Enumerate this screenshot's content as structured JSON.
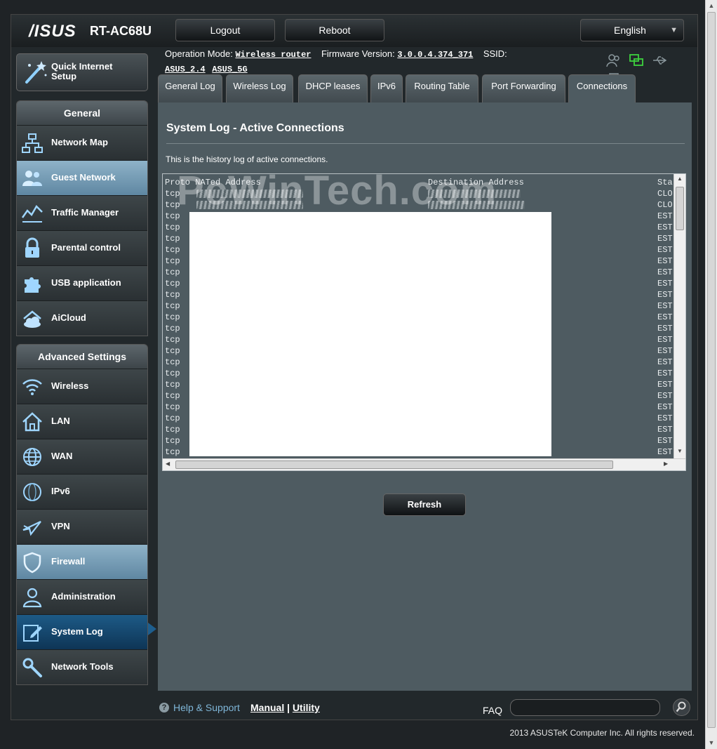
{
  "header": {
    "brand": "/ISUS",
    "model": "RT-AC68U",
    "logout_label": "Logout",
    "reboot_label": "Reboot",
    "language": "English"
  },
  "info": {
    "op_mode_label": "Operation Mode:",
    "op_mode_value": "Wireless router",
    "firmware_label": "Firmware Version:",
    "firmware_value": "3.0.0.4.374_371",
    "ssid_label": "SSID:",
    "ssid_values": [
      "ASUS_2.4",
      "ASUS_5G"
    ]
  },
  "sidebar": {
    "quick_setup_line1": "Quick Internet",
    "quick_setup_line2": "Setup",
    "general_title": "General",
    "general_items": [
      {
        "label": "Network Map",
        "icon": "network-map-icon"
      },
      {
        "label": "Guest Network",
        "icon": "guest-network-icon"
      },
      {
        "label": "Traffic Manager",
        "icon": "traffic-manager-icon"
      },
      {
        "label": "Parental control",
        "icon": "lock-icon"
      },
      {
        "label": "USB application",
        "icon": "puzzle-icon"
      },
      {
        "label": "AiCloud",
        "icon": "cloud-icon"
      }
    ],
    "advanced_title": "Advanced Settings",
    "advanced_items": [
      {
        "label": "Wireless",
        "icon": "wifi-icon"
      },
      {
        "label": "LAN",
        "icon": "home-icon"
      },
      {
        "label": "WAN",
        "icon": "globe-icon"
      },
      {
        "label": "IPv6",
        "icon": "ipv6-icon"
      },
      {
        "label": "VPN",
        "icon": "vpn-icon"
      },
      {
        "label": "Firewall",
        "icon": "shield-icon"
      },
      {
        "label": "Administration",
        "icon": "admin-icon"
      },
      {
        "label": "System Log",
        "icon": "edit-icon"
      },
      {
        "label": "Network Tools",
        "icon": "tools-icon"
      }
    ]
  },
  "tabs": [
    {
      "label": "General Log"
    },
    {
      "label": "Wireless Log"
    },
    {
      "label": "DHCP leases"
    },
    {
      "label": "IPv6"
    },
    {
      "label": "Routing Table"
    },
    {
      "label": "Port Forwarding"
    },
    {
      "label": "Connections"
    }
  ],
  "panel": {
    "title": "System Log - Active Connections",
    "description": "This is the history log of active connections.",
    "col_header": "Proto NATed Address",
    "dest_header": "Destination Address",
    "state_header": "Sta",
    "row_proto": "tcp",
    "state_values": [
      "CLO",
      "CLO",
      "EST"
    ],
    "watermark": "PcWinTech.com",
    "refresh_label": "Refresh"
  },
  "footer": {
    "help_label": "Help & Support",
    "manual_label": "Manual",
    "separator": "|",
    "utility_label": "Utility",
    "faq_label": "FAQ",
    "copyright": "2013 ASUSTeK Computer Inc. All rights reserved."
  },
  "colors": {
    "panel_bg": "#4e5b61",
    "highlight": "#7aa3bd",
    "active_nav": "#1d5a86",
    "help_link": "#7fb6d8"
  }
}
